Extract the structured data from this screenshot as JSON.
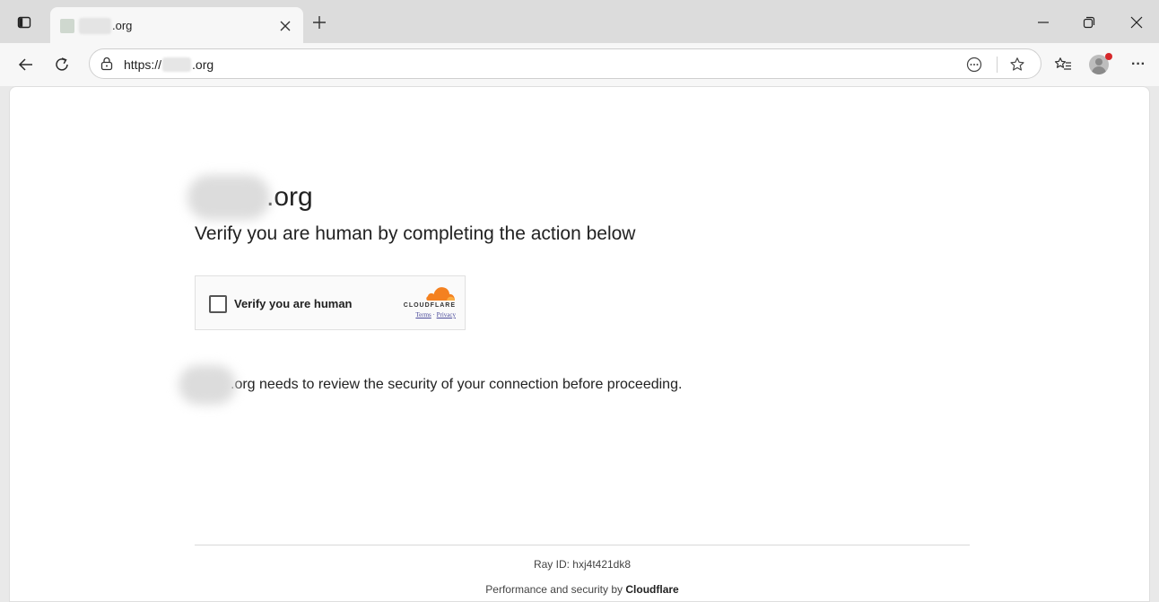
{
  "browser": {
    "tab": {
      "title_suffix": ".org"
    },
    "address_bar": {
      "prefix": "https://",
      "suffix": ".org"
    },
    "window_controls": {
      "minimize": "–",
      "restore": "⧉",
      "close": "✕"
    },
    "more_label": "···"
  },
  "page": {
    "site_domain_suffix": ".org",
    "heading": "Verify you are human by completing the action below",
    "widget": {
      "checkbox_label": "Verify you are human",
      "brand": "CLOUDFLARE",
      "terms_link": "Terms",
      "separator": "·",
      "privacy_link": "Privacy",
      "brand_color": "#f48120"
    },
    "review_text": ".org needs to review the security of your connection before proceeding.",
    "footer": {
      "ray_id": "Ray ID: hxj4t421dk8",
      "performance_prefix": "Performance and security by",
      "performance_brand": "Cloudflare"
    }
  }
}
